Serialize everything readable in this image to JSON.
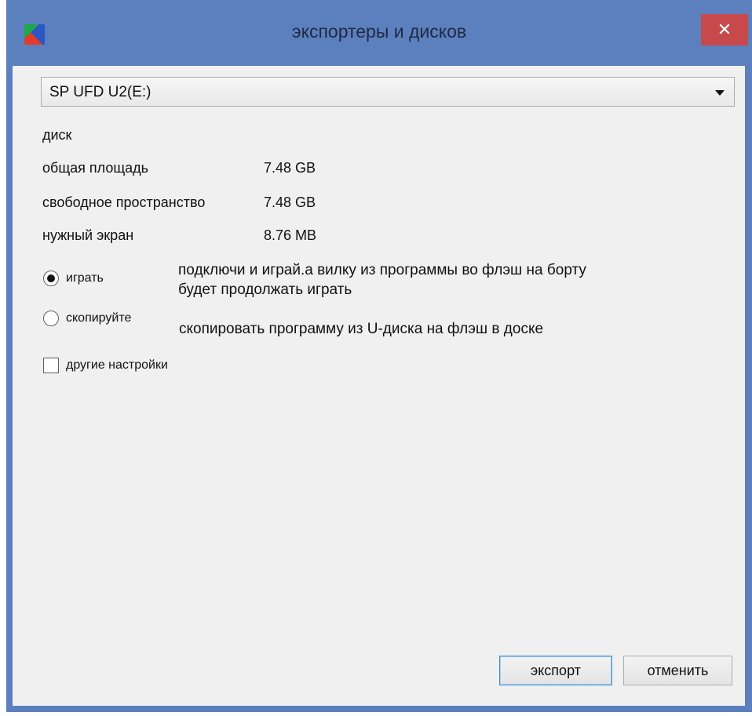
{
  "window": {
    "title": "экспортеры и дисков",
    "close_glyph": "✕"
  },
  "drive_select": {
    "selected": "SP UFD U2(E:)"
  },
  "section_label": "диск",
  "info": {
    "total_label": "общая площадь",
    "total_value": "7.48 GB",
    "free_label": "свободное пространство",
    "free_value": "7.48 GB",
    "needed_label": "нужный экран",
    "needed_value": "8.76 MB"
  },
  "modes": [
    {
      "label": "играть",
      "selected": true,
      "description_line1": "подключи и играй.а вилку из программы во флэш на борту",
      "description_line2": "будет продолжать играть"
    },
    {
      "label": "скопируйте",
      "selected": false,
      "description_line1": "скопировать программу из U-диска на флэш в доске"
    }
  ],
  "other_settings": {
    "label": "другие настройки",
    "checked": false
  },
  "buttons": {
    "export": "экспорт",
    "cancel": "отменить"
  },
  "icons": [
    "app-icon",
    "close-icon",
    "chevron-down-icon"
  ]
}
